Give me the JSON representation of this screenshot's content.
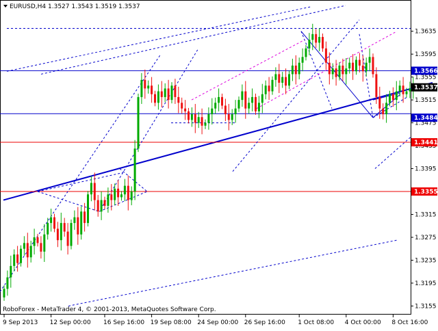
{
  "header": {
    "symbol_tf": "EURUSD,H4",
    "ohlc": "1.3527 1.3543 1.3519 1.3537"
  },
  "footer": {
    "copyright": "RoboForex - MetaTrader 4, © 2001-2013, MetaQuotes Software Corp."
  },
  "colors": {
    "background": "#ffffff",
    "bull": "#00aa00",
    "bear": "#ee1111",
    "trend": "#0000cc",
    "channel": "#dd00dd",
    "support_line": "#ee0000",
    "resistance_line": "#0000cc",
    "current_price_bg": "#0000cc"
  },
  "chart_data": {
    "type": "candlestick",
    "symbol": "EURUSD",
    "timeframe": "H4",
    "ylim": [
      1.314,
      1.368
    ],
    "y_ticks": [
      "1.3635",
      "1.3595",
      "1.3555",
      "1.3515",
      "1.3475",
      "1.3435",
      "1.3395",
      "1.3355",
      "1.3315",
      "1.3275",
      "1.3235",
      "1.3195",
      "1.3155"
    ],
    "x_labels": [
      {
        "label": "9 Sep 2013",
        "bar": 0
      },
      {
        "label": "12 Sep 00:00",
        "bar": 14
      },
      {
        "label": "16 Sep 16:00",
        "bar": 30
      },
      {
        "label": "19 Sep 08:00",
        "bar": 44
      },
      {
        "label": "24 Sep 00:00",
        "bar": 58
      },
      {
        "label": "26 Sep 16:00",
        "bar": 72
      },
      {
        "label": "1 Oct 08:00",
        "bar": 88
      },
      {
        "label": "4 Oct 00:00",
        "bar": 102
      },
      {
        "label": "8 Oct 16:00",
        "bar": 116
      }
    ],
    "price_labels": [
      {
        "value": "1.3566",
        "price": 1.3566,
        "style": "line-label"
      },
      {
        "value": "1.3537",
        "price": 1.3537,
        "style": "current"
      },
      {
        "value": "1.3484",
        "price": 1.3484,
        "style": "line-label"
      },
      {
        "value": "1.3441",
        "price": 1.3441,
        "style": "support"
      },
      {
        "value": "1.3355",
        "price": 1.3355,
        "style": "support"
      }
    ],
    "closes": [
      1.3185,
      1.3205,
      1.3225,
      1.3245,
      1.323,
      1.3255,
      1.3265,
      1.324,
      1.326,
      1.3275,
      1.3265,
      1.325,
      1.328,
      1.33,
      1.331,
      1.329,
      1.327,
      1.33,
      1.3285,
      1.326,
      1.33,
      1.331,
      1.328,
      1.332,
      1.33,
      1.335,
      1.337,
      1.334,
      1.332,
      1.334,
      1.333,
      1.335,
      1.334,
      1.336,
      1.3345,
      1.335,
      1.3365,
      1.334,
      1.3355,
      1.343,
      1.352,
      1.355,
      1.3535,
      1.354,
      1.3525,
      1.351,
      1.353,
      1.352,
      1.3535,
      1.3515,
      1.354,
      1.352,
      1.351,
      1.35,
      1.3495,
      1.348,
      1.349,
      1.3475,
      1.3485,
      1.347,
      1.3475,
      1.349,
      1.35,
      1.351,
      1.352,
      1.3505,
      1.349,
      1.348,
      1.349,
      1.35,
      1.3515,
      1.353,
      1.35,
      1.351,
      1.352,
      1.3495,
      1.351,
      1.3525,
      1.354,
      1.353,
      1.355,
      1.356,
      1.3545,
      1.3555,
      1.354,
      1.356,
      1.3575,
      1.356,
      1.358,
      1.359,
      1.3605,
      1.362,
      1.363,
      1.3615,
      1.3625,
      1.3605,
      1.358,
      1.356,
      1.357,
      1.3555,
      1.3575,
      1.356,
      1.357,
      1.358,
      1.3565,
      1.3585,
      1.3575,
      1.3565,
      1.358,
      1.359,
      1.356,
      1.352,
      1.35,
      1.349,
      1.351,
      1.3525,
      1.3515,
      1.353,
      1.354,
      1.3525,
      1.353,
      1.3535,
      1.3537
    ],
    "trendlines": [
      {
        "x1": 5,
        "y1": 1.334,
        "x2": 632,
        "y2": 1.3545,
        "color": "trend",
        "width": 2,
        "dash": false
      },
      {
        "x1": 0,
        "y1": 1.3491,
        "x2": 600,
        "y2": 1.3491,
        "color": "resistance_line",
        "width": 1,
        "dash": false
      },
      {
        "x1": 0,
        "y1": 1.3566,
        "x2": 600,
        "y2": 1.3566,
        "color": "resistance_line",
        "width": 1,
        "dash": false
      },
      {
        "x1": 0,
        "y1": 1.3441,
        "x2": 600,
        "y2": 1.3441,
        "color": "support_line",
        "width": 1,
        "dash": false
      },
      {
        "x1": 0,
        "y1": 1.3355,
        "x2": 600,
        "y2": 1.3355,
        "color": "support_line",
        "width": 1,
        "dash": false
      },
      {
        "x1": 10,
        "y1": 1.364,
        "x2": 600,
        "y2": 1.364,
        "color": "trend",
        "width": 1,
        "dash": true
      },
      {
        "x1": 60,
        "y1": 1.356,
        "x2": 505,
        "y2": 1.368,
        "color": "trend",
        "width": 1,
        "dash": true
      },
      {
        "x1": 10,
        "y1": 1.3565,
        "x2": 455,
        "y2": 1.3678,
        "color": "trend",
        "width": 1,
        "dash": true
      },
      {
        "x1": 0,
        "y1": 1.318,
        "x2": 235,
        "y2": 1.3595,
        "color": "trend",
        "width": 1,
        "dash": true
      },
      {
        "x1": 55,
        "y1": 1.3355,
        "x2": 180,
        "y2": 1.3388,
        "color": "trend",
        "width": 1,
        "dash": true
      },
      {
        "x1": 55,
        "y1": 1.3355,
        "x2": 145,
        "y2": 1.332,
        "color": "trend",
        "width": 1,
        "dash": true
      },
      {
        "x1": 145,
        "y1": 1.332,
        "x2": 215,
        "y2": 1.3355,
        "color": "trend",
        "width": 1,
        "dash": true
      },
      {
        "x1": 175,
        "y1": 1.3395,
        "x2": 215,
        "y2": 1.3355,
        "color": "trend",
        "width": 1,
        "dash": true
      },
      {
        "x1": 150,
        "y1": 1.333,
        "x2": 290,
        "y2": 1.3605,
        "color": "trend",
        "width": 1,
        "dash": true
      },
      {
        "x1": 100,
        "y1": 1.3155,
        "x2": 580,
        "y2": 1.327,
        "color": "trend",
        "width": 1,
        "dash": true
      },
      {
        "x1": 340,
        "y1": 1.339,
        "x2": 525,
        "y2": 1.3655,
        "color": "trend",
        "width": 1,
        "dash": true
      },
      {
        "x1": 440,
        "y1": 1.3635,
        "x2": 545,
        "y2": 1.3484,
        "color": "trend",
        "width": 1,
        "dash": false
      },
      {
        "x1": 440,
        "y1": 1.3635,
        "x2": 485,
        "y2": 1.35,
        "color": "trend",
        "width": 1,
        "dash": true
      },
      {
        "x1": 525,
        "y1": 1.363,
        "x2": 545,
        "y2": 1.3484,
        "color": "trend",
        "width": 1,
        "dash": true
      },
      {
        "x1": 545,
        "y1": 1.3484,
        "x2": 585,
        "y2": 1.3525,
        "color": "trend",
        "width": 1,
        "dash": false
      },
      {
        "x1": 545,
        "y1": 1.3515,
        "x2": 585,
        "y2": 1.3527,
        "color": "trend",
        "width": 1,
        "dash": false
      },
      {
        "x1": 545,
        "y1": 1.3484,
        "x2": 595,
        "y2": 1.352,
        "color": "trend",
        "width": 1,
        "dash": true
      },
      {
        "x1": 548,
        "y1": 1.3395,
        "x2": 600,
        "y2": 1.345,
        "color": "trend",
        "width": 1,
        "dash": true
      },
      {
        "x1": 250,
        "y1": 1.3475,
        "x2": 345,
        "y2": 1.3475,
        "color": "trend",
        "width": 1,
        "dash": true
      },
      {
        "x1": 280,
        "y1": 1.3515,
        "x2": 445,
        "y2": 1.362,
        "color": "channel",
        "width": 1,
        "dash": true
      },
      {
        "x1": 375,
        "y1": 1.35,
        "x2": 580,
        "y2": 1.3635,
        "color": "channel",
        "width": 1,
        "dash": true
      }
    ]
  }
}
